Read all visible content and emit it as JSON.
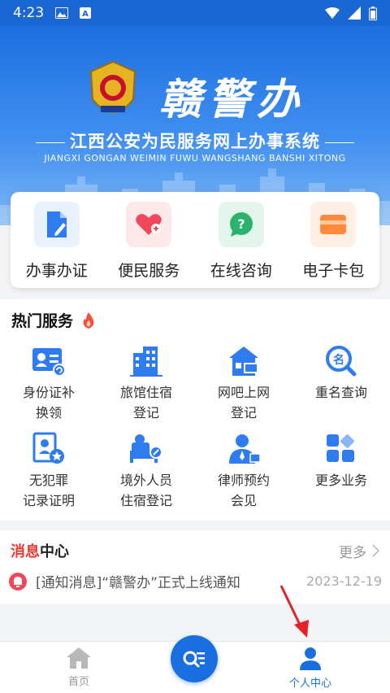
{
  "status_bar": {
    "time": "4:23"
  },
  "banner": {
    "logo_text": "赣警办",
    "title": "江西公安为民服务网上办事系统",
    "subtitle": "JIANGXI GONGAN WEIMIN FUWU WANGSHANG BANSHI XITONG"
  },
  "quick_actions": [
    {
      "label": "办事办证",
      "icon": "document-icon",
      "color": "#2f7bf0",
      "bg": "#e8f1fe"
    },
    {
      "label": "便民服务",
      "icon": "heart-icon",
      "color": "#f0475a",
      "bg": "#fde8ea"
    },
    {
      "label": "在线咨询",
      "icon": "chat-question-icon",
      "color": "#29b36b",
      "bg": "#e4f6ec"
    },
    {
      "label": "电子卡包",
      "icon": "card-wallet-icon",
      "color": "#ff8a3d",
      "bg": "#fff0e6"
    }
  ],
  "hot_services": {
    "title": "热门服务",
    "items": [
      {
        "label": "身份证补\n换领",
        "icon": "id-card-icon"
      },
      {
        "label": "旅馆住宿\n登记",
        "icon": "hotel-building-icon"
      },
      {
        "label": "网吧上网\n登记",
        "icon": "internet-cafe-icon"
      },
      {
        "label": "重名查询",
        "icon": "name-search-icon"
      },
      {
        "label": "无犯罪\n记录证明",
        "icon": "certificate-icon"
      },
      {
        "label": "境外人员\n住宿登记",
        "icon": "foreigner-bed-icon"
      },
      {
        "label": "律师预约\n会见",
        "icon": "lawyer-icon"
      },
      {
        "label": "更多业务",
        "icon": "more-grid-icon"
      }
    ]
  },
  "messages": {
    "title_highlight": "消息",
    "title_rest": "中心",
    "more_label": "更多",
    "items": [
      {
        "text": "[通知消息]“赣警办”正式上线通知",
        "date": "2023-12-19"
      }
    ]
  },
  "bottom_nav": {
    "home_label": "首页",
    "profile_label": "个人中心",
    "accent": "#1a6fe0"
  }
}
